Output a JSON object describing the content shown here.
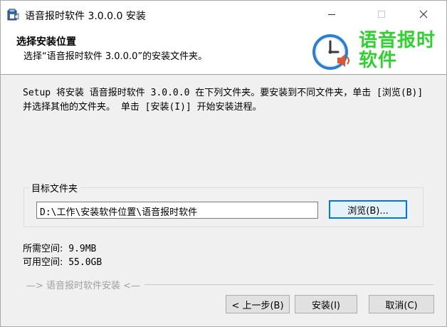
{
  "window": {
    "title": "语音报时软件 3.0.0.0 安装",
    "icons": {
      "app": "installer-app-icon",
      "min": "minimize-icon",
      "max": "maximize-icon",
      "close": "close-icon"
    }
  },
  "header": {
    "title": "选择安装位置",
    "subtitle": "选择“语音报时软件 3.0.0.0”的安装文件夹。",
    "logo_text_line1": "语音报时",
    "logo_text_line2": "软件",
    "logo_icon": "clock-speaker-icon",
    "logo_color": "#2fd12f"
  },
  "body": {
    "intro": "Setup 将安装 语音报时软件 3.0.0.0 在下列文件夹。要安装到不同文件夹，单击 [浏览(B)] 并选择其他的文件夹。 单击 [安装(I)] 开始安装进程。",
    "group_label": "目标文件夹",
    "install_path": "D:\\工作\\安装软件位置\\语音报时软件",
    "browse_label": "浏览(B)...",
    "space_required_label": "所需空间:",
    "space_required_value": "9.9MB",
    "space_available_label": "可用空间:",
    "space_available_value": "55.0GB"
  },
  "footer": {
    "branding": "—> 语音报时软件安装 <—",
    "back_label": "< 上一步(B)",
    "install_label": "安装(I)",
    "cancel_label": "取消(C)"
  }
}
